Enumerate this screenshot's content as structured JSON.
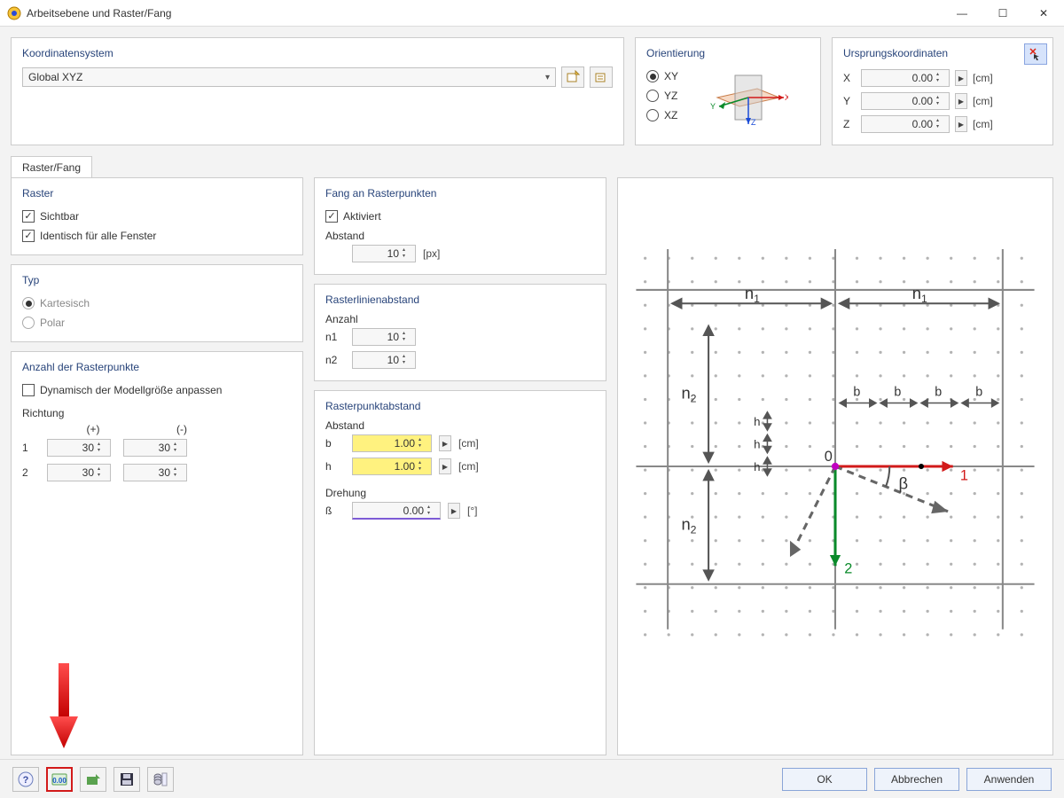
{
  "window": {
    "title": "Arbeitsebene und Raster/Fang"
  },
  "coord": {
    "title": "Koordinatensystem",
    "selected": "Global XYZ"
  },
  "orient": {
    "title": "Orientierung",
    "options": [
      "XY",
      "YZ",
      "XZ"
    ],
    "selected": "XY",
    "axes": {
      "x": "X",
      "y": "Y",
      "z": "Z"
    }
  },
  "origin": {
    "title": "Ursprungskoordinaten",
    "unit": "[cm]",
    "x_label": "X",
    "x_value": "0.00",
    "y_label": "Y",
    "y_value": "0.00",
    "z_label": "Z",
    "z_value": "0.00"
  },
  "tabs": {
    "rasterfang": "Raster/Fang"
  },
  "raster": {
    "title": "Raster",
    "sichtbar": "Sichtbar",
    "identisch": "Identisch für alle Fenster"
  },
  "typ": {
    "title": "Typ",
    "kartesisch": "Kartesisch",
    "polar": "Polar"
  },
  "anzahl": {
    "title": "Anzahl der Rasterpunkte",
    "dynamisch": "Dynamisch der Modellgröße anpassen",
    "richtung": "Richtung",
    "plus": "(+)",
    "minus": "(-)",
    "row1_label": "1",
    "row1_plus": "30",
    "row1_minus": "30",
    "row2_label": "2",
    "row2_plus": "30",
    "row2_minus": "30"
  },
  "fang": {
    "title": "Fang an Rasterpunkten",
    "aktiviert": "Aktiviert",
    "abstand_label": "Abstand",
    "abstand_value": "10",
    "abstand_unit": "[px]"
  },
  "linien": {
    "title": "Rasterlinienabstand",
    "anzahl_label": "Anzahl",
    "n1_label": "n1",
    "n1_value": "10",
    "n2_label": "n2",
    "n2_value": "10"
  },
  "punkt": {
    "title": "Rasterpunktabstand",
    "abstand_label": "Abstand",
    "b_label": "b",
    "b_value": "1.00",
    "b_unit": "[cm]",
    "h_label": "h",
    "h_value": "1.00",
    "h_unit": "[cm]",
    "drehung_label": "Drehung",
    "beta_label": "ß",
    "beta_value": "0.00",
    "beta_unit": "[°]"
  },
  "diagram": {
    "n1": "n",
    "n1_sub": "1",
    "n2": "n",
    "n2_sub": "2",
    "b": "b",
    "h": "h",
    "origin": "0",
    "axis1": "1",
    "axis2": "2",
    "beta": "β"
  },
  "footer": {
    "ok": "OK",
    "cancel": "Abbrechen",
    "apply": "Anwenden"
  }
}
